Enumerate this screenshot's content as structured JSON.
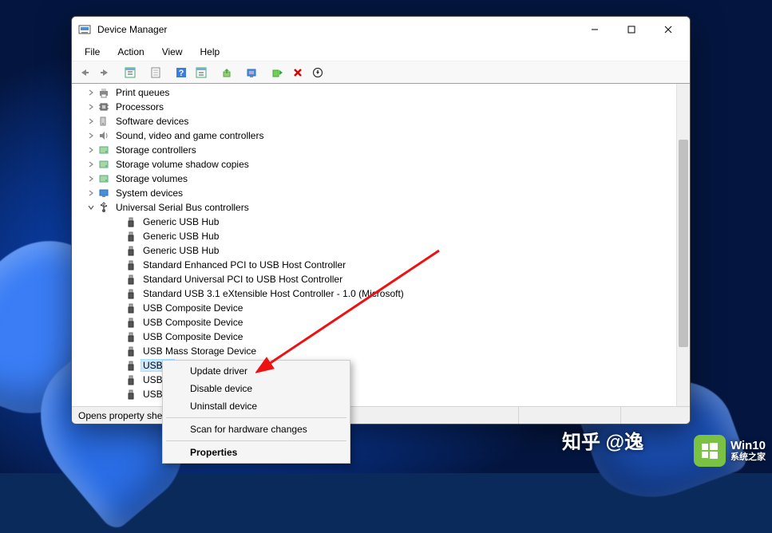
{
  "window": {
    "title": "Device Manager"
  },
  "menubar": {
    "items": [
      {
        "label": "File"
      },
      {
        "label": "Action"
      },
      {
        "label": "View"
      },
      {
        "label": "Help"
      }
    ]
  },
  "tree": {
    "collapsed": [
      {
        "label": "Print queues",
        "icon": "printer"
      },
      {
        "label": "Processors",
        "icon": "cpu"
      },
      {
        "label": "Software devices",
        "icon": "software"
      },
      {
        "label": "Sound, video and game controllers",
        "icon": "sound"
      },
      {
        "label": "Storage controllers",
        "icon": "storage"
      },
      {
        "label": "Storage volume shadow copies",
        "icon": "storage"
      },
      {
        "label": "Storage volumes",
        "icon": "storage"
      },
      {
        "label": "System devices",
        "icon": "system"
      }
    ],
    "expanded": {
      "label": "Universal Serial Bus controllers",
      "icon": "usb",
      "children": [
        {
          "label": "Generic USB Hub"
        },
        {
          "label": "Generic USB Hub"
        },
        {
          "label": "Generic USB Hub"
        },
        {
          "label": "Standard Enhanced PCI to USB Host Controller"
        },
        {
          "label": "Standard Universal PCI to USB Host Controller"
        },
        {
          "label": "Standard USB 3.1 eXtensible Host Controller - 1.0 (Microsoft)"
        },
        {
          "label": "USB Composite Device"
        },
        {
          "label": "USB Composite Device"
        },
        {
          "label": "USB Composite Device"
        },
        {
          "label": "USB Mass Storage Device"
        },
        {
          "label": "USB R",
          "selected": true
        },
        {
          "label": "USB R"
        },
        {
          "label": "USB R"
        }
      ]
    }
  },
  "contextmenu": {
    "items": [
      {
        "label": "Update driver"
      },
      {
        "label": "Disable device"
      },
      {
        "label": "Uninstall device"
      }
    ],
    "scan": "Scan for hardware changes",
    "properties": "Properties"
  },
  "statusbar": {
    "text": "Opens property sheet"
  },
  "watermark": {
    "zhihu": "知乎 @逸",
    "win10_line1": "Win10",
    "win10_line2": "系统之家"
  }
}
